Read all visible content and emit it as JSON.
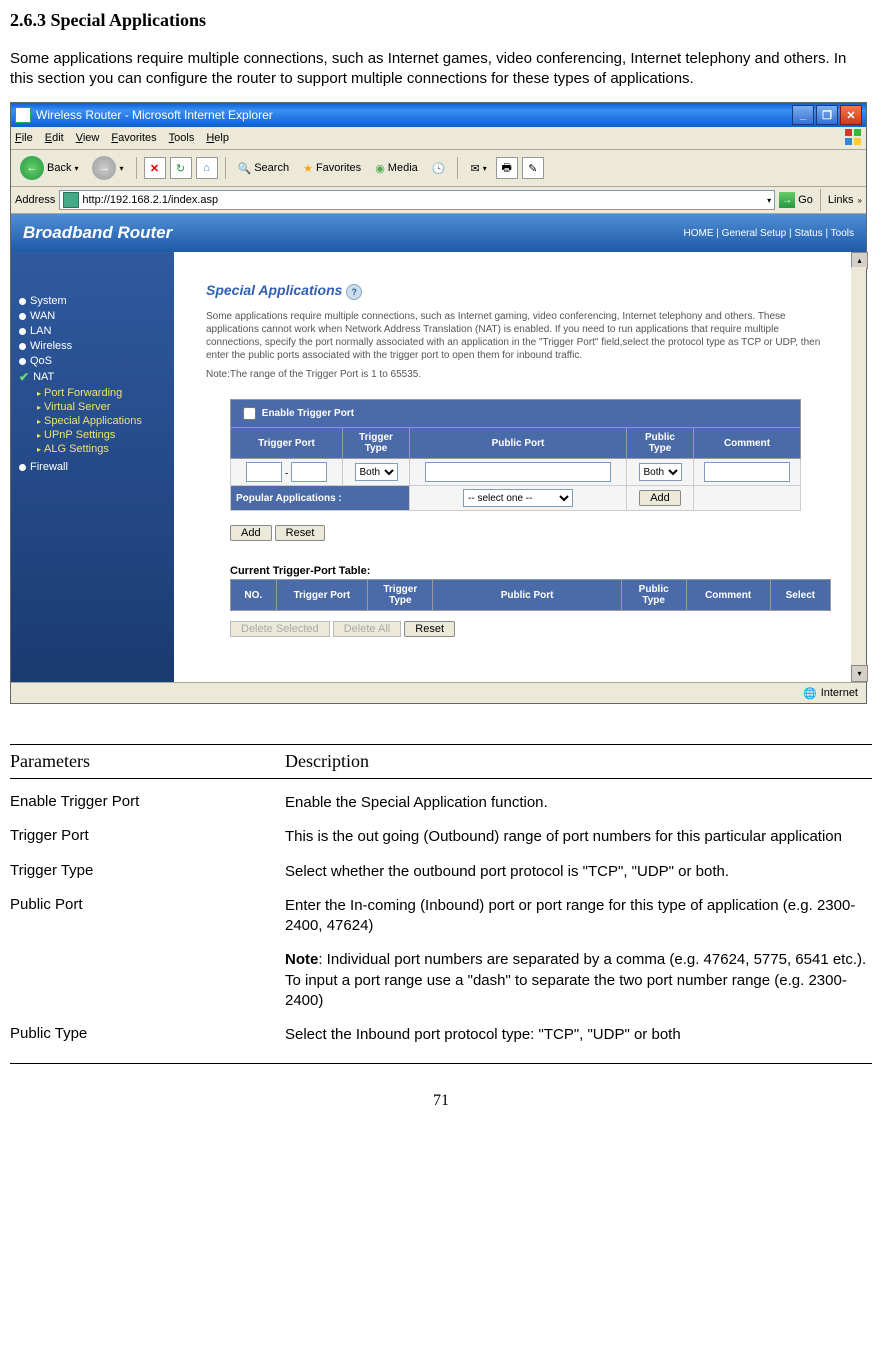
{
  "section_title": "2.6.3 Special Applications",
  "intro": "Some applications require multiple connections, such as Internet games, video conferencing, Internet telephony and others. In this section you can configure the router to support multiple connections for these types of applications.",
  "browser": {
    "window_title": "Wireless Router - Microsoft Internet Explorer",
    "menu": {
      "file": "File",
      "edit": "Edit",
      "view": "View",
      "favorites": "Favorites",
      "tools": "Tools",
      "help": "Help"
    },
    "toolbar": {
      "back": "Back",
      "search": "Search",
      "favorites": "Favorites",
      "media": "Media"
    },
    "address_label": "Address",
    "address_url": "http://192.168.2.1/index.asp",
    "go": "Go",
    "links": "Links"
  },
  "banner": {
    "brand": "Broadband Router",
    "nav": "HOME | General Setup | Status | Tools"
  },
  "sidebar": {
    "system": "System",
    "wan": "WAN",
    "lan": "LAN",
    "wireless": "Wireless",
    "qos": "QoS",
    "nat": "NAT",
    "nat_sub": {
      "pf": "Port Forwarding",
      "vs": "Virtual Server",
      "sa": "Special Applications",
      "upnp": "UPnP Settings",
      "alg": "ALG Settings"
    },
    "firewall": "Firewall"
  },
  "pane": {
    "title": "Special Applications",
    "desc": "Some applications require multiple connections, such as Internet gaming, video conferencing, Internet telephony and others. These applications cannot work when Network Address Translation (NAT) is enabled. If you need to run applications that require multiple connections, specify the port normally associated with an application in the \"Trigger Port\" field,select the protocol type as TCP or UDP, then enter the public ports associated with the trigger port to open them for inbound traffic.",
    "note": "Note:The range of the Trigger Port is 1 to 65535.",
    "enable_cb": "Enable Trigger Port",
    "headers": {
      "tp": "Trigger Port",
      "tt": "Trigger Type",
      "pp": "Public Port",
      "pt": "Public Type",
      "cm": "Comment"
    },
    "both": "Both",
    "popular": "Popular Applications :",
    "select_one": "-- select one --",
    "add": "Add",
    "reset": "Reset",
    "current_table": "Current Trigger-Port Table:",
    "table_headers": {
      "no": "NO.",
      "tp": "Trigger Port",
      "tt": "Trigger Type",
      "pp": "Public Port",
      "pt": "Public Type",
      "cm": "Comment",
      "sel": "Select"
    },
    "del_sel": "Delete Selected",
    "del_all": "Delete All"
  },
  "statusbar": {
    "zone": "Internet"
  },
  "params": {
    "header_param": "Parameters",
    "header_desc": "Description",
    "rows": [
      {
        "name": "Enable Trigger Port",
        "desc": "Enable the Special Application function."
      },
      {
        "name": "Trigger Port",
        "desc": "This is the out going (Outbound) range of port numbers for this particular application"
      },
      {
        "name": "Trigger Type",
        "desc": "Select whether the outbound port protocol is \"TCP\", \"UDP\" or both."
      },
      {
        "name": "Public Port",
        "desc": "Enter the In-coming (Inbound) port or port range for this type of application (e.g. 2300-2400, 47624)"
      },
      {
        "name": "",
        "desc_note_label": "Note",
        "desc_note": ": Individual port numbers are separated by a comma (e.g. 47624, 5775, 6541 etc.). To input a port range use a \"dash\" to separate the two port number range (e.g. 2300-2400)"
      },
      {
        "name": "Public Type",
        "desc": "Select the Inbound port protocol type: \"TCP\", \"UDP\" or both"
      }
    ]
  },
  "page_number": "71"
}
